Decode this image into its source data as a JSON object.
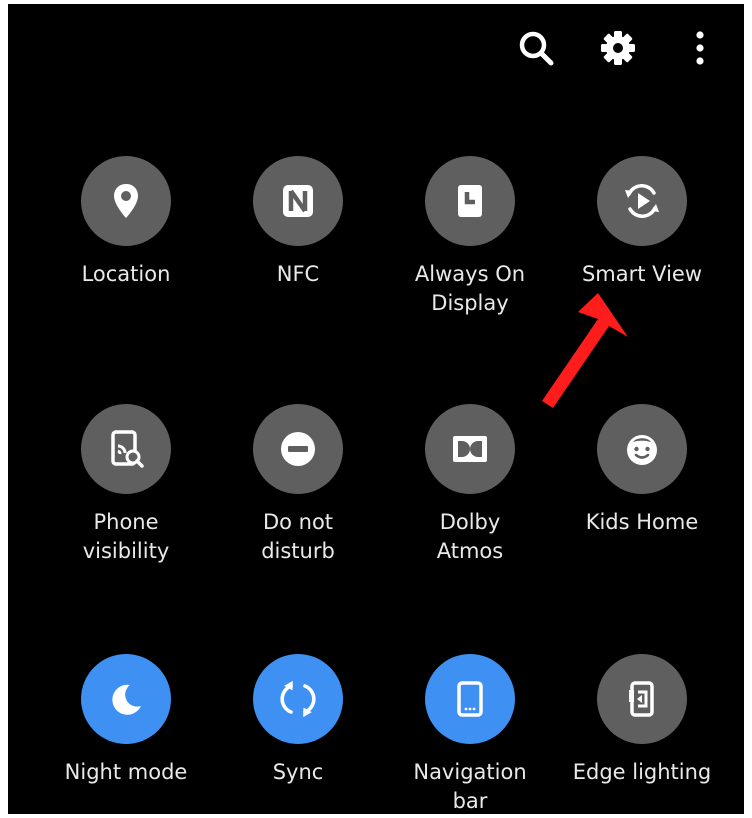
{
  "topbar": {
    "icons": [
      "search-icon",
      "gear-icon",
      "more-vertical-icon"
    ]
  },
  "tiles": [
    {
      "label": "Location",
      "icon": "location-pin-icon",
      "active": false
    },
    {
      "label": "NFC",
      "icon": "nfc-icon",
      "active": false
    },
    {
      "label": "Always On\nDisplay",
      "icon": "always-on-display-icon",
      "active": false
    },
    {
      "label": "Smart View",
      "icon": "smart-view-icon",
      "active": false
    },
    {
      "label": "Phone\nvisibility",
      "icon": "phone-visibility-icon",
      "active": false
    },
    {
      "label": "Do not\ndisturb",
      "icon": "do-not-disturb-icon",
      "active": false
    },
    {
      "label": "Dolby\nAtmos",
      "icon": "dolby-atmos-icon",
      "active": false
    },
    {
      "label": "Kids Home",
      "icon": "kids-home-icon",
      "active": false
    },
    {
      "label": "Night mode",
      "icon": "moon-icon",
      "active": true
    },
    {
      "label": "Sync",
      "icon": "sync-icon",
      "active": true
    },
    {
      "label": "Navigation\nbar",
      "icon": "navigation-bar-icon",
      "active": true
    },
    {
      "label": "Edge lighting",
      "icon": "edge-lighting-icon",
      "active": false
    }
  ],
  "colors": {
    "panel_bg": "#000000",
    "tile_off": "#5f5f5f",
    "tile_on": "#3e91f2",
    "label": "#e9e9e9",
    "annotation_arrow": "#ff1c1c"
  }
}
